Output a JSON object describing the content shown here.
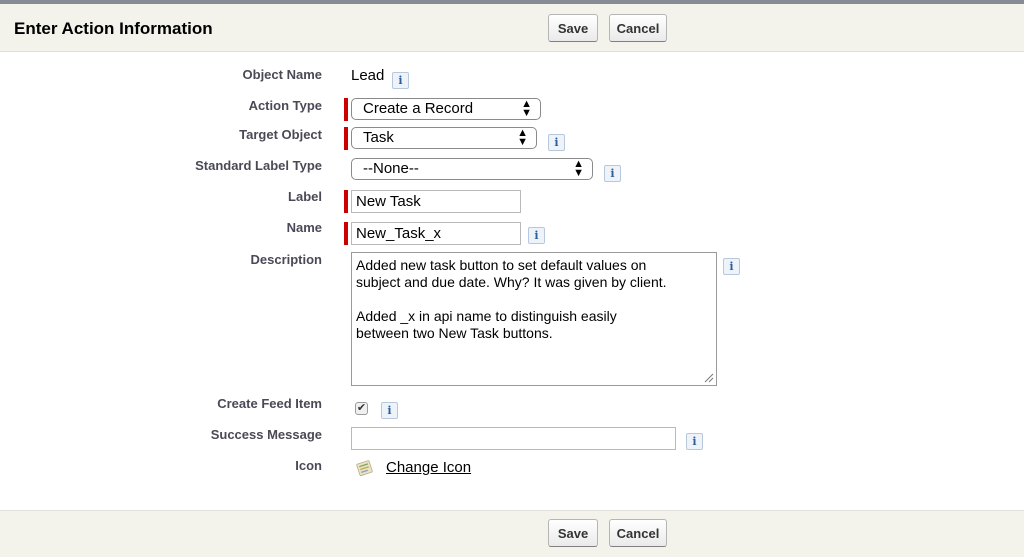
{
  "header": {
    "title": "Enter Action Information",
    "save_label": "Save",
    "cancel_label": "Cancel"
  },
  "footer": {
    "save_label": "Save",
    "cancel_label": "Cancel"
  },
  "form": {
    "object_name": {
      "label": "Object Name",
      "value": "Lead"
    },
    "action_type": {
      "label": "Action Type",
      "value": "Create a Record"
    },
    "target_object": {
      "label": "Target Object",
      "value": "Task"
    },
    "standard_label_type": {
      "label": "Standard Label Type",
      "value": "--None--"
    },
    "label_field": {
      "label": "Label",
      "value": "New Task"
    },
    "name_field": {
      "label": "Name",
      "value": "New_Task_x"
    },
    "description": {
      "label": "Description",
      "value": "Added new task button to set default values on\nsubject and due date. Why? It was given by client.\n\nAdded _x in api name to distinguish easily\nbetween two New Task buttons."
    },
    "create_feed_item": {
      "label": "Create Feed Item",
      "checked": true,
      "check_glyph": "✔"
    },
    "success_message": {
      "label": "Success Message",
      "value": ""
    },
    "icon": {
      "label": "Icon",
      "link_text": "Change Icon"
    }
  },
  "info_glyph": "i",
  "colors": {
    "required_bar": "#cc0000",
    "header_bg": "#f3f3ec",
    "label_color": "#4a4a56"
  }
}
